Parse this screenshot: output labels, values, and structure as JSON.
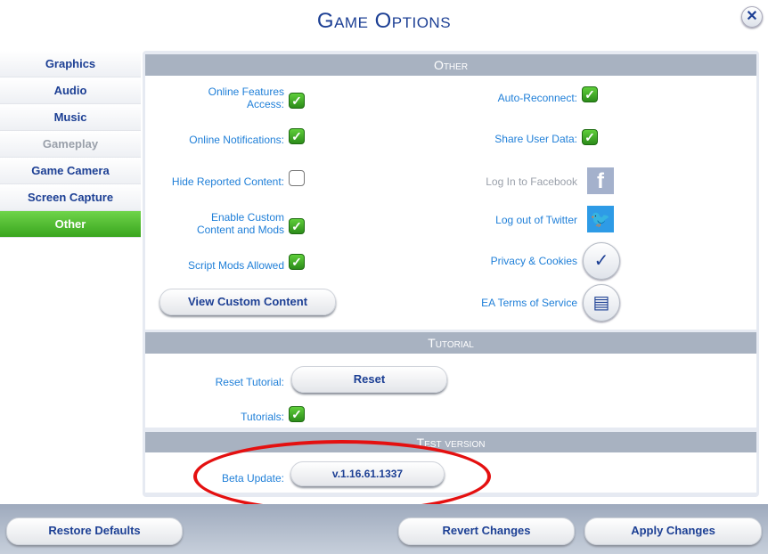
{
  "title": "Game Options",
  "close_icon": "close-icon",
  "sidebar": {
    "items": [
      {
        "label": "Graphics",
        "state": "normal"
      },
      {
        "label": "Audio",
        "state": "normal"
      },
      {
        "label": "Music",
        "state": "normal"
      },
      {
        "label": "Gameplay",
        "state": "disabled"
      },
      {
        "label": "Game Camera",
        "state": "normal"
      },
      {
        "label": "Screen Capture",
        "state": "normal"
      },
      {
        "label": "Other",
        "state": "active"
      }
    ]
  },
  "other": {
    "header": "Other",
    "online_features": {
      "label_1": "Online Features",
      "label_2": "Access:",
      "checked": true
    },
    "online_notifications": {
      "label": "Online Notifications:",
      "checked": true
    },
    "hide_reported": {
      "label": "Hide Reported Content:",
      "checked": false
    },
    "custom_content": {
      "label_1": "Enable Custom",
      "label_2": "Content and Mods",
      "checked": true
    },
    "script_mods": {
      "label": "Script Mods Allowed",
      "checked": true
    },
    "view_cc_button": "View Custom Content",
    "auto_reconnect": {
      "label": "Auto-Reconnect:",
      "checked": true
    },
    "share_user_data": {
      "label": "Share User Data:",
      "checked": true
    },
    "facebook": {
      "label": "Log In to Facebook",
      "icon": "facebook-icon"
    },
    "twitter": {
      "label": "Log out of Twitter",
      "icon": "twitter-icon"
    },
    "privacy": {
      "label": "Privacy & Cookies",
      "icon": "shield-check-icon"
    },
    "terms": {
      "label": "EA Terms of Service",
      "icon": "document-icon"
    }
  },
  "tutorial": {
    "header": "Tutorial",
    "reset_label": "Reset Tutorial:",
    "reset_button": "Reset",
    "tutorials_label": "Tutorials:",
    "tutorials_checked": true
  },
  "test_version": {
    "header": "Test version",
    "beta_label": "Beta Update:",
    "version": "v.1.16.61.1337"
  },
  "footer": {
    "restore": "Restore Defaults",
    "revert": "Revert Changes",
    "apply": "Apply Changes"
  },
  "colors": {
    "accent_green": "#39a51e",
    "label_blue": "#1f7fd8",
    "annotation_red": "#e41010"
  }
}
